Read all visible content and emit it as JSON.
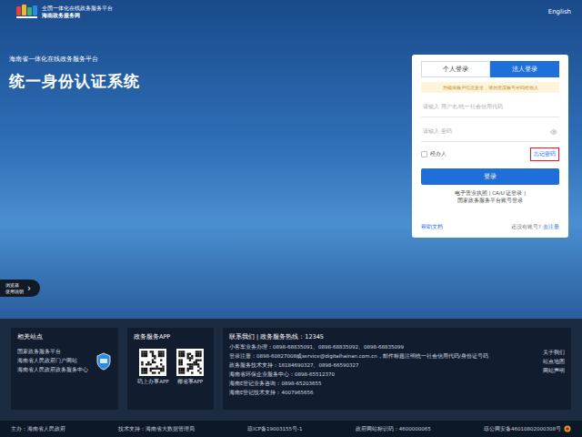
{
  "header": {
    "platform_name": "全国一体化在线政务服务平台",
    "site_name": "海南政务服务网",
    "language": "English"
  },
  "hero": {
    "subtitle": "海南省一体化在线政务服务平台",
    "title": "统一身份认证系统"
  },
  "browser_guide": {
    "lines": [
      "浏览器",
      "使用说明"
    ],
    "arrow": "›"
  },
  "login": {
    "tabs": [
      {
        "label": "个人登录",
        "selected": false
      },
      {
        "label": "法人登录",
        "selected": true
      }
    ],
    "notice": "为确保账户信息安全，请勿泄露账号密码给他人",
    "username_placeholder": "请输入 用户名/统一社会信用代码",
    "password_placeholder": "请输入 密码",
    "agent_checkbox": {
      "label": "经办人",
      "checked": false
    },
    "forgot_password": {
      "label": "忘记密码",
      "highlighted": true
    },
    "submit": "登录",
    "alt_login": [
      "电子营业执照 | CA/U 证登录 |",
      "国家政务服务平台账号登录"
    ],
    "help": "帮助文档",
    "register_prompt": "还没有账号?",
    "register_link": "去注册"
  },
  "footer": {
    "related": {
      "title": "相关站点",
      "links": [
        "国家政务服务平台",
        "海南省人民政府门户网站",
        "海南省人民政府政务服务中心"
      ]
    },
    "app": {
      "title": "政务服务APP",
      "apps": [
        "码上办事APP",
        "椰省事APP"
      ]
    },
    "contact": {
      "title": "联系我们 | 政务服务热线：12345",
      "lines": [
        "小客车业务办理：0898-68835091、0898-68835092、0898-68835099",
        "登录注册：0898-60827008或service@digitalhainan.com.cn，邮件标题注明统一社会信用代码/身份证号码",
        "政务服务技术支持：18184690327、0898-66590327",
        "海南省环保企业服务中心：0898-65512370",
        "海南E登记业务咨询：0898-65203655",
        "海南E登记技术支持：4007965656"
      ]
    },
    "links": [
      "关于我们",
      "站点地图",
      "网站声明"
    ]
  },
  "bottom_bar": [
    "主办：海南省人民政府",
    "技术支持：海南省大数据管理局",
    "琼ICP备19003155号-1",
    "政府网站标识码：4600000065",
    "琼公网安备46010802000308号"
  ]
}
